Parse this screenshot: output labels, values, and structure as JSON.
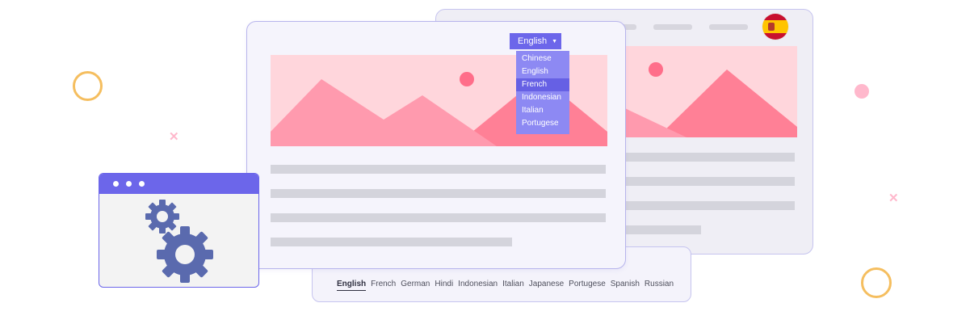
{
  "colors": {
    "accent": "#6c66ea",
    "accent_light": "#8d89f3",
    "hero_bg": "#ffd6dc",
    "mountain": "#ff9aae",
    "mountain_dark": "#ff8096",
    "sun": "#ff6e8a",
    "ring": "#f5be5f",
    "pink_dot": "#ffb8cc",
    "gear": "#5a6aae",
    "placeholder_bar": "#d4d4dc"
  },
  "language_selector": {
    "selected": "English",
    "options": [
      "Chinese",
      "English",
      "French",
      "Indonesian",
      "Italian",
      "Portugese"
    ],
    "highlighted": "French"
  },
  "language_bar": {
    "active": "English",
    "items": [
      "English",
      "French",
      "German",
      "Hindi",
      "Indonesian",
      "Italian",
      "Japanese",
      "Portugese",
      "Spanish",
      "Russian"
    ]
  },
  "back_window": {
    "flag": "spain-flag-icon"
  },
  "icons": {
    "settings_window": "gear-icon",
    "caret": "caret-down-icon",
    "hero": "landscape-image-icon"
  }
}
